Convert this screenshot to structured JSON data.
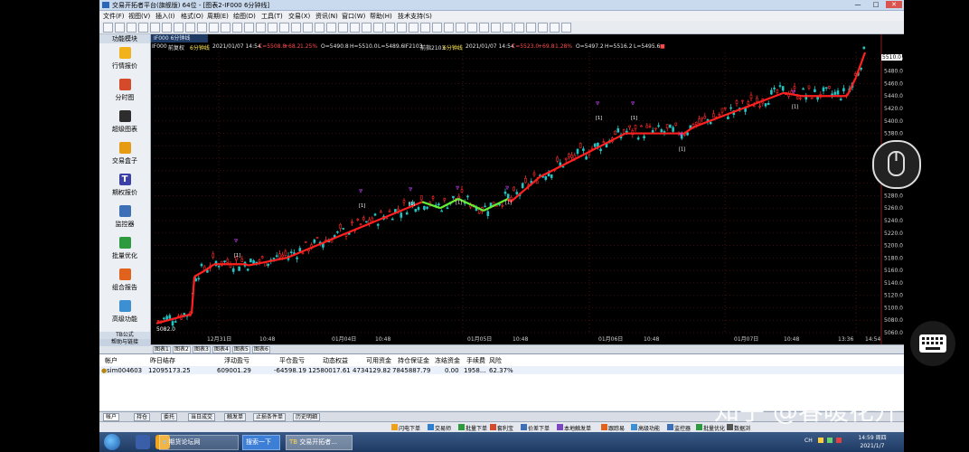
{
  "window": {
    "title": "交易开拓者平台(旗舰版) 64位 - [图表2-IF000 6分钟线]",
    "controls": [
      "—",
      "□",
      "✕"
    ]
  },
  "menu": [
    "文件(F)",
    "视图(V)",
    "插入(I)",
    "格式(O)",
    "周期(E)",
    "绘图(D)",
    "工具(T)",
    "交易(X)",
    "资讯(N)",
    "窗口(W)",
    "帮助(H)",
    "技术支持(S)"
  ],
  "left_panel": {
    "header": "功能模块",
    "items": [
      {
        "label": "行情报价",
        "icon": "quote-icon",
        "color": "#f1b21c"
      },
      {
        "label": "分时图",
        "icon": "timeshare-icon",
        "color": "#d44a2a"
      },
      {
        "label": "超级图表",
        "icon": "chart-icon",
        "color": "#2d2d2d"
      },
      {
        "label": "交易盒子",
        "icon": "box-icon",
        "color": "#e59b12"
      },
      {
        "label": "期权报价",
        "icon": "option-icon",
        "color": "#3b3fa8",
        "glyph": "T"
      },
      {
        "label": "监控器",
        "icon": "monitor-icon",
        "color": "#3c6fb5"
      },
      {
        "label": "批量优化",
        "icon": "optimize-icon",
        "color": "#2e9a3e"
      },
      {
        "label": "组合报告",
        "icon": "report-icon",
        "color": "#e0621c"
      },
      {
        "label": "高级功能",
        "icon": "advanced-icon",
        "color": "#3c8fd1"
      }
    ],
    "footer_items": [
      "TB公式",
      "帮助与链接"
    ]
  },
  "chart": {
    "tab_label": "IF000 6分钟线",
    "status_left": {
      "symbol": "IF000",
      "mode": "前复权",
      "bar": "6分钟线",
      "date": "2021/01/07 14:54",
      "close": "C=5508.8",
      "change": "+68.2",
      "pct": "1.25%",
      "open": "O=5490.8",
      "high": "H=5510.0",
      "low": "L=5489.6",
      "extra": "IF2103"
    },
    "status_right": {
      "label": "前指2103",
      "bar": "6分钟线",
      "date": "2021/01/07 14:54",
      "close": "C=5523.0",
      "change": "+69.8",
      "pct": "1.28%",
      "open": "O=5497.2",
      "high": "H=5516.2",
      "low": "L=5495.6",
      "tag": "■"
    },
    "price_axis": [
      "5500.0",
      "5480.0",
      "5460.0",
      "5440.0",
      "5420.0",
      "5400.0",
      "5380.0",
      "5360.0",
      "5340.0",
      "5320.0",
      "5300.0",
      "5280.0",
      "5260.0",
      "5240.0",
      "5220.0",
      "5200.0",
      "5180.0",
      "5160.0",
      "5140.0",
      "5120.0",
      "5100.0",
      "5080.0",
      "5060.0"
    ],
    "last_price_label": "5510.0",
    "x_labels": [
      "12月31日",
      "10:48",
      "01月04日",
      "10:48",
      "01月05日",
      "10:48",
      "01月06日",
      "10:48",
      "01月07日",
      "10:48",
      "13:36",
      "14:54"
    ],
    "first_bar_label": "5082.0",
    "signal_label": "[1]",
    "colors": {
      "up": "#ff2a2a",
      "down": "#25c4c4",
      "trend_up": "#ff2020",
      "trend_flat": "#66ee33",
      "signal": "#cc44ff"
    }
  },
  "chart_tabs": [
    "图表1",
    "图表2",
    "图表3",
    "图表4",
    "图表5",
    "图表6"
  ],
  "account": {
    "headers": [
      "帐户",
      "昨日结存",
      "浮动盈亏",
      "平仓盈亏",
      "动态权益",
      "可用资金",
      "持仓保证金",
      "冻结资金",
      "手续费",
      "风险"
    ],
    "row": [
      "sim004603",
      "12095173.25",
      "609001.29",
      "-64598.19",
      "12580017.61",
      "4734129.82",
      "7845887.79",
      "0.00",
      "1958...",
      "62.37%"
    ]
  },
  "account_tabs": [
    "帐户",
    "持仓",
    "委托",
    "当日成交",
    "触发单",
    "止损条件单",
    "历史明细"
  ],
  "status_items": [
    "闪电下单",
    "交易师",
    "批量下单",
    "套利宝",
    "价差下单",
    "本地触发单",
    "跟踪易",
    "高级功能",
    "监控器",
    "批量优化",
    "数据浏"
  ],
  "taskbar": {
    "apps": [
      {
        "label": "期货论坛网",
        "type": "ie"
      },
      {
        "label": "搜索一下",
        "type": "search"
      },
      {
        "label": "交易开拓者...",
        "type": "app"
      }
    ],
    "clock_time": "14:59 周四",
    "clock_date": "2021/1/7",
    "tray": "CH"
  },
  "watermark": "知乎 @春暖花开"
}
